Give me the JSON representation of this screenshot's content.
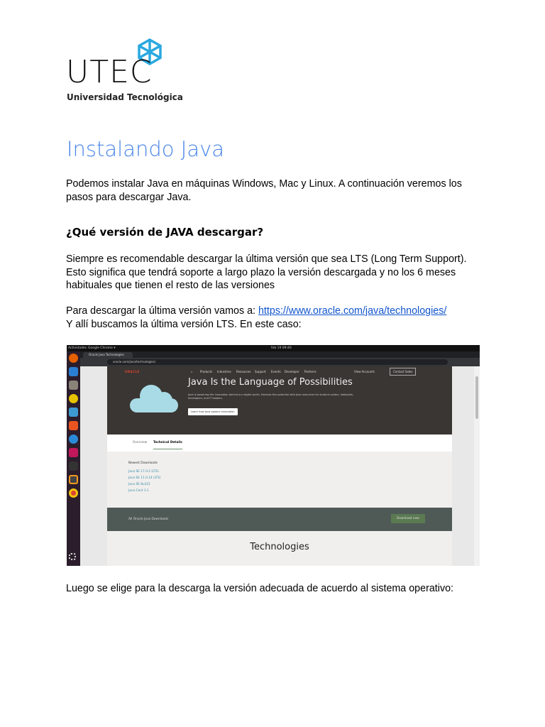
{
  "logo": {
    "name": "UTEC",
    "subtitle": "Universidad Tecnológica"
  },
  "title": "Instalando Java",
  "intro": "Podemos instalar Java en máquinas Windows, Mac y Linux. A continuación veremos los pasos para descargar Java.",
  "section_heading": "¿Qué versión de JAVA descargar?",
  "lts_paragraph": "Siempre es recomendable descargar la última versión que sea LTS (Long Term Support). Esto significa que tendrá soporte a largo plazo la versión descargada y no los 6 meses habituales que tienen el resto de las versiones",
  "download_prefix": "Para descargar la última versión vamos a: ",
  "download_url": "https://www.oracle.com/java/technologies/",
  "download_suffix": "Y allí buscamos la última versión LTS. En este caso:",
  "closing": "Luego se elige para la descarga la versión adecuada de acuerdo al sistema operativo:",
  "screenshot": {
    "activities": "Actividades",
    "app": "Google Chrome ▾",
    "clock": "feb 19 09:40",
    "tab_title": "Oracle Java Technologies",
    "url": "oracle.com/java/technologies/",
    "brand": "ORACLE",
    "nav": [
      "Products",
      "Industries",
      "Resources",
      "Support",
      "Events",
      "Developer",
      "Partners"
    ],
    "view_accounts": "View Accounts",
    "contact_sales": "Contact Sales",
    "hero_title": "Java Is the Language of Possibilities",
    "hero_text": "Java is powering the innovation behind our digital world. Harness this potential with Java resources for student coders, hobbyists, developers, and IT leaders.",
    "hero_button": "Learn how Java powers innovation",
    "tabs": [
      "Overview",
      "Technical Details"
    ],
    "newest": "Newest Downloads",
    "downloads": [
      "Java SE 17.0.2 (LTS)",
      "Java SE 11.0.14 (LTS)",
      "Java SE 8u321",
      "Java Card 3.1"
    ],
    "all_downloads": "All Oracle Java Downloads",
    "download_now": "Download now",
    "technologies": "Technologies"
  }
}
